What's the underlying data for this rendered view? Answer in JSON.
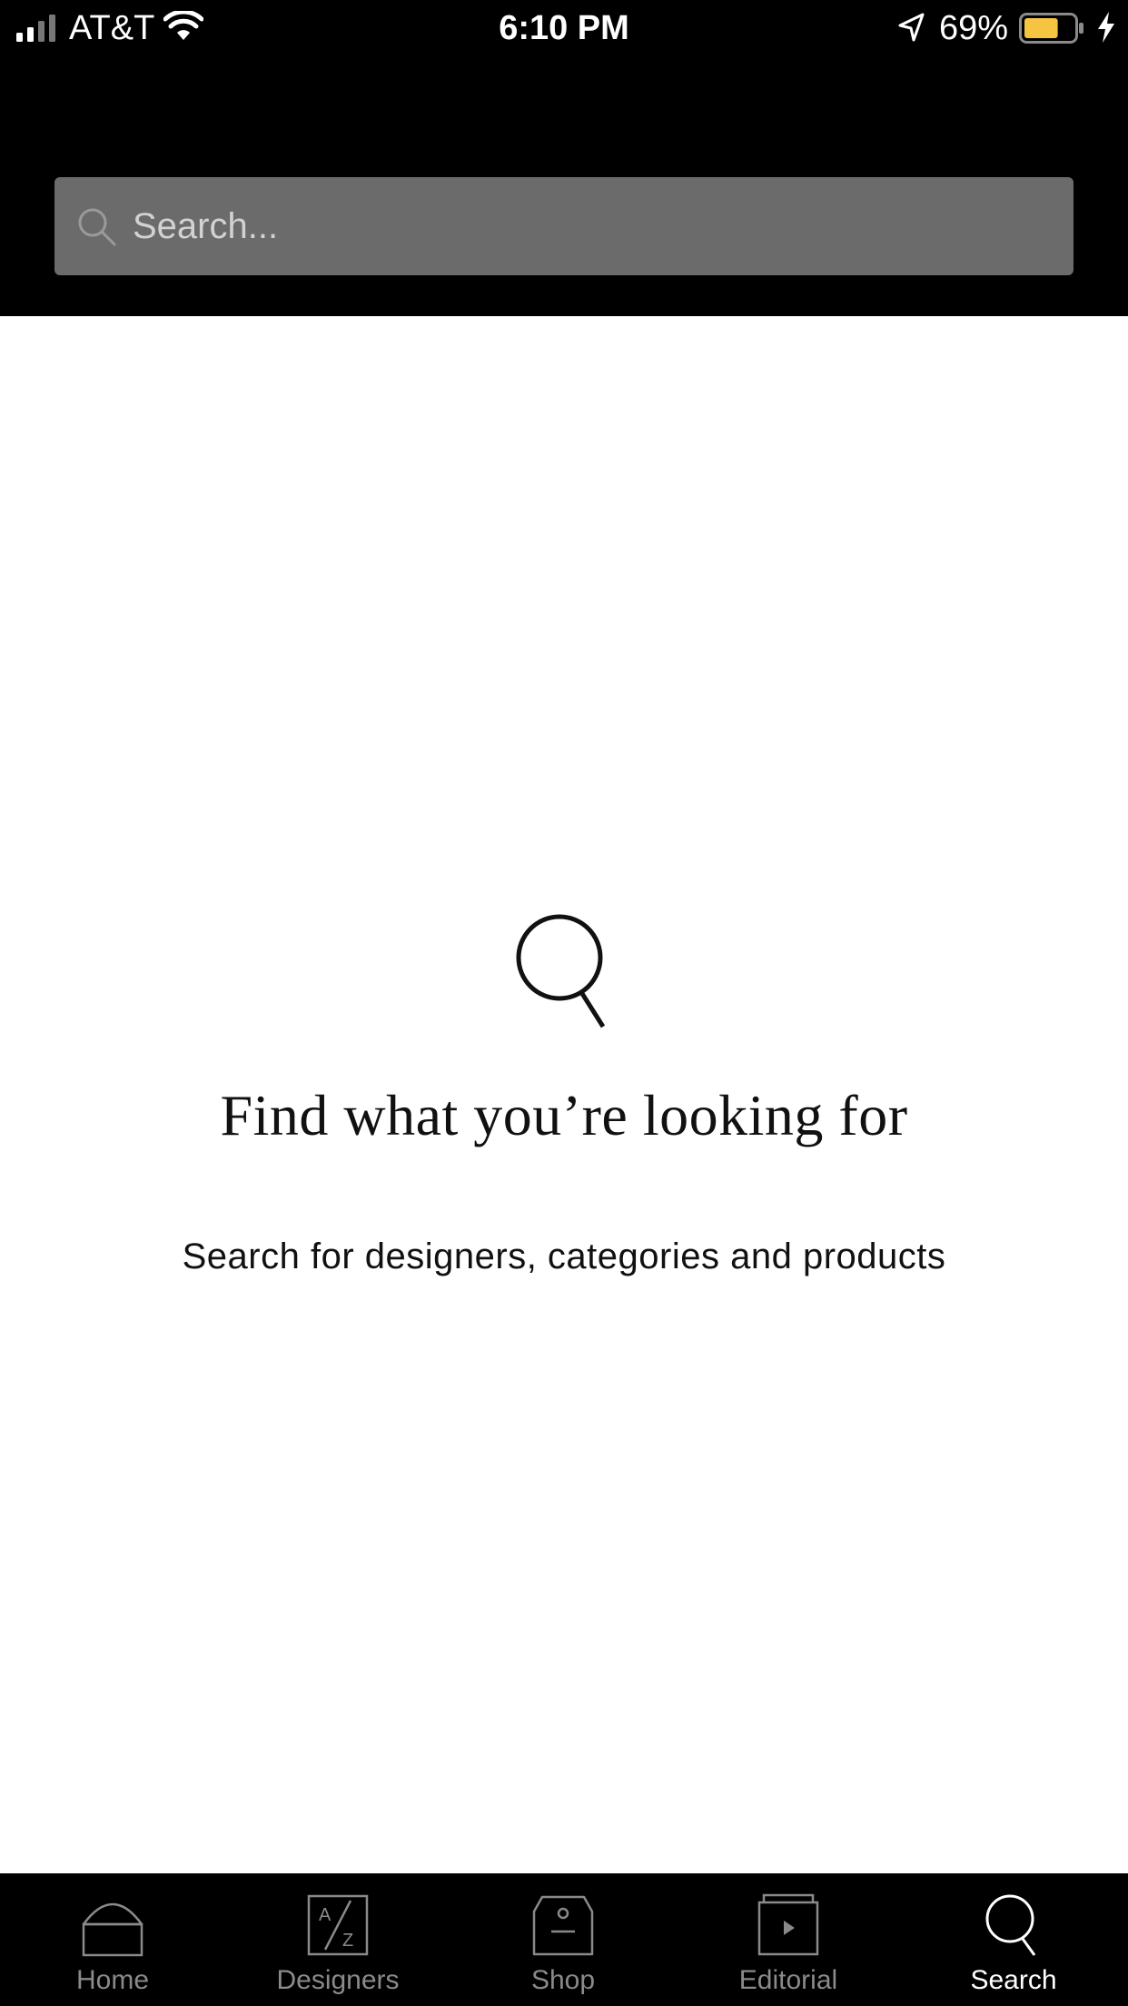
{
  "status_bar": {
    "carrier": "AT&T",
    "time": "6:10 PM",
    "battery_percent": "69%",
    "battery_level": 0.69,
    "battery_color": "#f5c542",
    "icons": [
      "signal-icon",
      "wifi-icon",
      "location-arrow-icon",
      "battery-icon",
      "charging-bolt-icon"
    ]
  },
  "search": {
    "placeholder": "Search...",
    "value": "",
    "icon": "search-icon"
  },
  "empty_state": {
    "icon": "magnifier-icon",
    "title": "Find what you’re looking for",
    "subtitle": "Search for designers, categories and products"
  },
  "tab_bar": {
    "active_tab": "Search",
    "active_color": "#ffffff",
    "inactive_color": "#8a8a8a",
    "tabs": [
      {
        "label": "Home",
        "icon": "home-icon"
      },
      {
        "label": "Designers",
        "icon": "a-z-icon"
      },
      {
        "label": "Shop",
        "icon": "shopping-bag-icon"
      },
      {
        "label": "Editorial",
        "icon": "play-icon"
      },
      {
        "label": "Search",
        "icon": "search-icon"
      }
    ]
  }
}
